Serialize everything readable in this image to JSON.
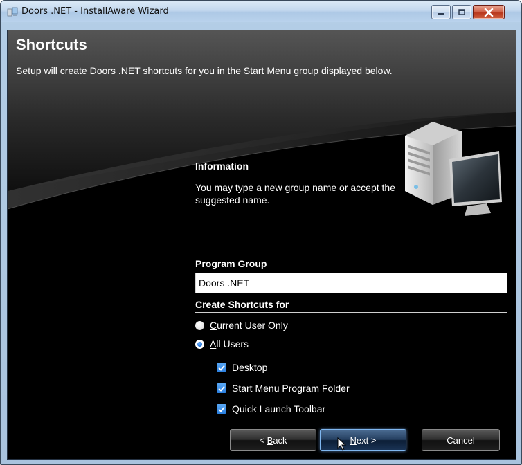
{
  "window": {
    "title": "Doors .NET - InstallAware Wizard"
  },
  "header": {
    "title": "Shortcuts",
    "subtitle": "Setup will create Doors .NET shortcuts for you in the Start Menu group displayed below."
  },
  "info": {
    "heading": "Information",
    "text": "You may type a new group name or accept the suggested name."
  },
  "program_group": {
    "label": "Program Group",
    "value": "Doors .NET"
  },
  "shortcuts": {
    "label": "Create Shortcuts for",
    "options": [
      {
        "accel": "C",
        "rest": "urrent User Only",
        "selected": false
      },
      {
        "accel": "A",
        "rest": "ll Users",
        "selected": true
      }
    ],
    "locations": [
      {
        "label": "Desktop",
        "checked": true
      },
      {
        "label": "Start Menu Program Folder",
        "checked": true
      },
      {
        "label": "Quick Launch Toolbar",
        "checked": true
      }
    ]
  },
  "buttons": {
    "back_prefix": "< ",
    "back_accel": "B",
    "back_rest": "ack",
    "next_accel": "N",
    "next_rest": "ext >",
    "cancel": "Cancel"
  }
}
